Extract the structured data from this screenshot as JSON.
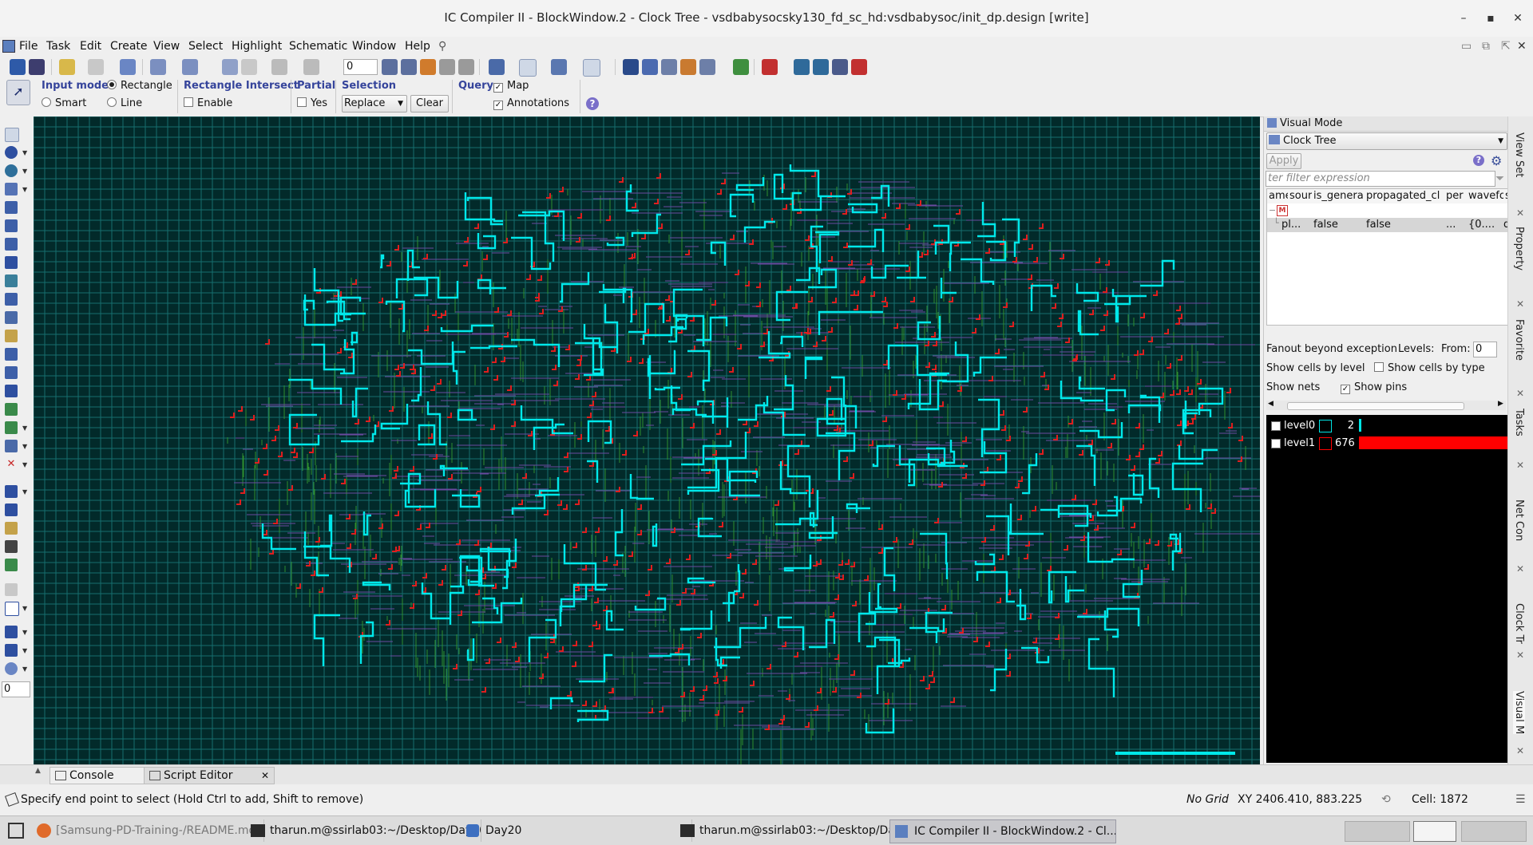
{
  "window": {
    "title": "IC Compiler II - BlockWindow.2 - Clock Tree - vsdbabysocsky130_fd_sc_hd:vsdbabysoc/init_dp.design [write]",
    "minimize": "–",
    "maximize": "▪",
    "close": "✕"
  },
  "menu": [
    "File",
    "Task",
    "Edit",
    "Create",
    "View",
    "Select",
    "Highlight",
    "Schematic",
    "Window",
    "Help"
  ],
  "toolbar": {
    "layer_value": "0"
  },
  "options": {
    "input_mode_title": "Input mode",
    "rectangle": "Rectangle",
    "smart": "Smart",
    "line": "Line",
    "rect_intersect_title": "Rectangle Intersect",
    "enable": "Enable",
    "partial_title": "Partial",
    "yes": "Yes",
    "selection_title": "Selection",
    "selection_value": "Replace",
    "clear_button": "Clear",
    "query_title": "Query",
    "map": "Map",
    "annotations": "Annotations",
    "help_icon": "?"
  },
  "left_tools": {
    "counter_value": "0"
  },
  "visual_mode": {
    "header": "Visual Mode",
    "mode": "Clock Tree",
    "apply_button": "Apply",
    "filter_placeholder": "ter filter expression",
    "columns": [
      "ame",
      "sour",
      "is_genera",
      "propagated_cl",
      "per",
      "wavefo",
      "sk"
    ],
    "tree_root_badge": "M",
    "row": [
      "pl...",
      "false",
      "false",
      "...",
      "{0....",
      "d"
    ],
    "fanout_label": "Fanout beyond exception",
    "levels_label": "Levels:",
    "from_label": "From:",
    "from_value": "0",
    "show_cells_by_level": "Show cells by level",
    "show_cells_by_type": "Show cells by type",
    "show_nets": "Show nets",
    "show_pins": "Show pins",
    "levels": [
      {
        "name": "level0",
        "count": "2",
        "color": "#00e5e5",
        "fraction": 0.003
      },
      {
        "name": "level1",
        "count": "676",
        "color": "#ff0000",
        "fraction": 1.0
      }
    ]
  },
  "side_tabs": [
    "View Set",
    "Property",
    "Favorite",
    "Tasks",
    "Net Con",
    "Clock Tr",
    "Visual M"
  ],
  "bottom_tabs": [
    {
      "label": "Console"
    },
    {
      "label": "Script Editor"
    }
  ],
  "status": {
    "message": "Specify end point to select (Hold Ctrl to add, Shift to remove)",
    "grid": "No Grid",
    "coords": "XY 2406.410, 883.225",
    "cell": "Cell: 1872"
  },
  "taskbar": [
    {
      "label": "[Samsung-PD-Training-/README.md..."
    },
    {
      "label": "tharun.m@ssirlab03:~/Desktop/Day20"
    },
    {
      "label": "Day20"
    },
    {
      "label": "tharun.m@ssirlab03:~/Desktop/Day..."
    },
    {
      "label": "IC Compiler II - BlockWindow.2 - Cl..."
    }
  ]
}
